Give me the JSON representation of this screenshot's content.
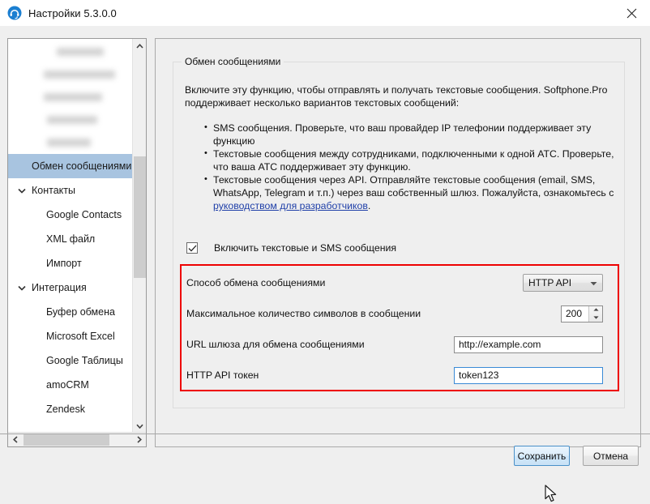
{
  "window": {
    "title": "Настройки 5.3.0.0",
    "app_icon": "headset-icon",
    "close_icon": "close-icon"
  },
  "sidebar": {
    "blurred_rows": 5,
    "items": [
      {
        "label": "Обмен сообщениями",
        "level": "lvl0",
        "selected": true
      },
      {
        "label": "Контакты",
        "level": "group",
        "twisty": "chevron-down-icon",
        "selected": false
      },
      {
        "label": "Google Contacts",
        "level": "child",
        "selected": false
      },
      {
        "label": "XML файл",
        "level": "child",
        "selected": false
      },
      {
        "label": "Импорт",
        "level": "child",
        "selected": false
      },
      {
        "label": "Интеграция",
        "level": "group",
        "twisty": "chevron-down-icon",
        "selected": false
      },
      {
        "label": "Буфер обмена",
        "level": "child",
        "selected": false
      },
      {
        "label": "Microsoft Excel",
        "level": "child",
        "selected": false
      },
      {
        "label": "Google Таблицы",
        "level": "child",
        "selected": false
      },
      {
        "label": "amoCRM",
        "level": "child",
        "selected": false
      },
      {
        "label": "Zendesk",
        "level": "child",
        "selected": false
      }
    ],
    "scroll": {
      "up_icon": "chevron-up-icon",
      "down_icon": "chevron-down-icon",
      "left_icon": "chevron-left-icon",
      "right_icon": "chevron-right-icon"
    }
  },
  "main": {
    "group_title": "Обмен сообщениями",
    "intro": "Включите эту функцию, чтобы отправлять и получать текстовые сообщения. Softphone.Pro поддерживает несколько вариантов текстовых сообщений:",
    "bullets": [
      {
        "text": "SMS сообщения. Проверьте, что ваш провайдер IP телефонии поддерживает эту функцию"
      },
      {
        "text": "Текстовые сообщения между сотрудниками, подключенными к одной АТС. Проверьте, что ваша АТС поддерживает эту функцию."
      },
      {
        "text_before": "Текстовые сообщения через API. Отправляйте текстовые сообщения (email, SMS, WhatsApp, Telegram и т.п.) через ваш собственный шлюз. Пожалуйста, ознакомьтесь с ",
        "link": "руководством для разработчиков",
        "text_after": "."
      }
    ],
    "checkbox": {
      "label": "Включить текстовые и SMS сообщения",
      "checked": true,
      "check_icon": "checkmark-icon"
    },
    "form": {
      "method": {
        "label": "Способ обмена сообщениями",
        "value": "HTTP API",
        "caret_icon": "caret-down-icon"
      },
      "max_chars": {
        "label": "Максимальное количество символов в сообщении",
        "value": "200",
        "up_icon": "spinner-up-icon",
        "down_icon": "spinner-down-icon"
      },
      "gateway_url": {
        "label": "URL шлюза для обмена сообщениями",
        "value": "http://example.com"
      },
      "api_token": {
        "label": "HTTP API токен",
        "value": "token123",
        "focused": true
      }
    },
    "highlight_color": "#ee0000"
  },
  "footer": {
    "save_label": "Сохранить",
    "cancel_label": "Отмена",
    "save_hovered": true
  },
  "cursor": {
    "icon": "mouse-pointer-icon"
  }
}
